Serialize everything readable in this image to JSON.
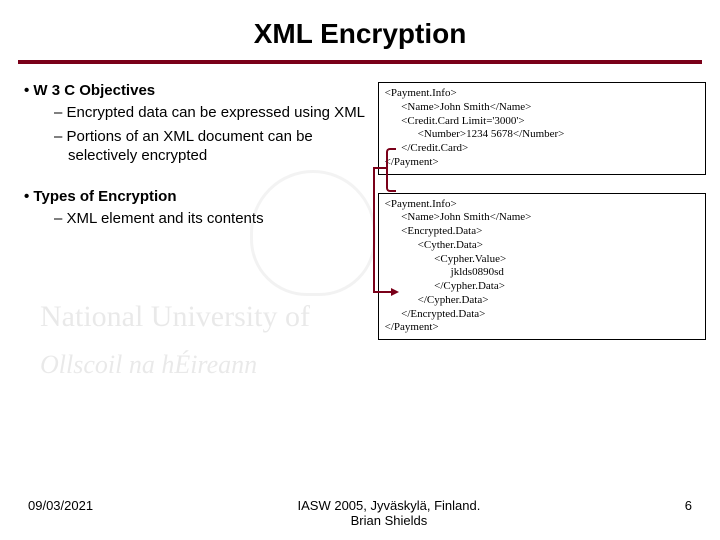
{
  "title": "XML Encryption",
  "sections": [
    {
      "heading": "W 3 C Objectives",
      "bullets": [
        "Encrypted data can be expressed using XML",
        "Portions of an XML document can be selectively encrypted"
      ]
    },
    {
      "heading": "Types of Encryption",
      "bullets": [
        "XML element and its contents"
      ]
    }
  ],
  "codeboxes": [
    "<Payment.Info>\n      <Name>John Smith</Name>\n      <Credit.Card Limit='3000'>\n            <Number>1234 5678</Number>\n      </Credit.Card>\n</Payment>",
    "<Payment.Info>\n      <Name>John Smith</Name>\n      <Encrypted.Data>\n            <Cyther.Data>\n                  <Cypher.Value>\n                        jklds0890sd\n                  </Cypher.Data>\n            </Cypher.Data>\n      </Encrypted.Data>\n</Payment>"
  ],
  "footer": {
    "date": "09/03/2021",
    "venue": "IASW 2005, Jyväskylä, Finland.\nBrian Shields",
    "page": "6"
  },
  "watermark": {
    "line1": "National University of",
    "line2": "Ollscoil na hÉireann"
  }
}
